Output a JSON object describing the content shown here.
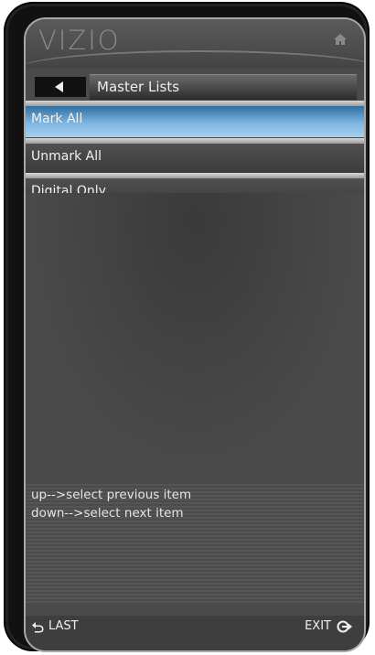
{
  "header": {
    "logo": "VIZIO",
    "home_icon": "home-icon"
  },
  "title_bar": {
    "back_icon": "back-arrow-icon",
    "title": "Master Lists"
  },
  "menu": {
    "items": [
      {
        "label": "Mark All",
        "selected": true
      },
      {
        "label": "Unmark All",
        "selected": false
      },
      {
        "label": "Digital Only",
        "selected": false
      }
    ]
  },
  "help": {
    "lines": [
      "up-->select previous item",
      "down-->select next item"
    ]
  },
  "footer": {
    "last_label": "LAST",
    "last_icon": "return-arrow-icon",
    "exit_label": "EXIT",
    "exit_icon": "exit-icon"
  },
  "colors": {
    "selected_top": "#2f6ea0",
    "selected_bottom": "#a8d0ee",
    "panel": "#4a4a4a"
  }
}
